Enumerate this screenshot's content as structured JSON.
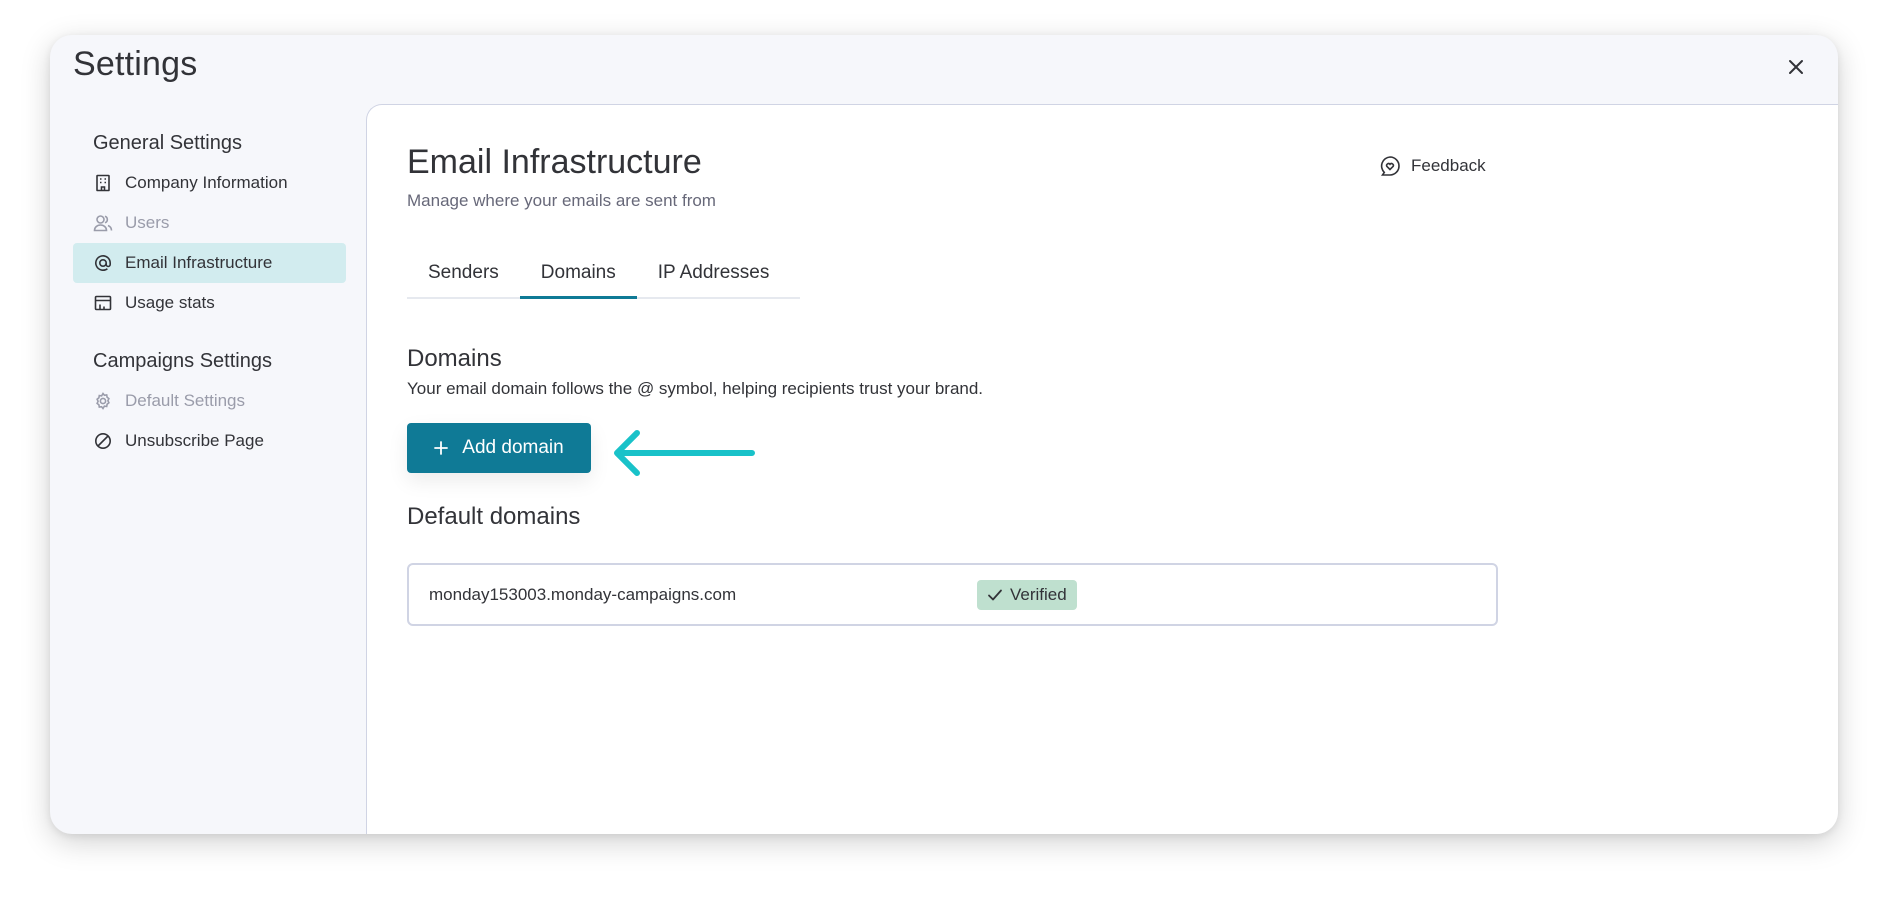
{
  "modal": {
    "title": "Settings"
  },
  "sidebar": {
    "general_title": "General Settings",
    "general_items": [
      {
        "label": "Company Information",
        "icon": "building-icon"
      },
      {
        "label": "Users",
        "icon": "users-icon",
        "disabled": true
      },
      {
        "label": "Email Infrastructure",
        "icon": "at-sign-icon",
        "active": true
      },
      {
        "label": "Usage stats",
        "icon": "usage-stats-icon"
      }
    ],
    "campaigns_title": "Campaigns Settings",
    "campaigns_items": [
      {
        "label": "Default Settings",
        "icon": "gear-icon",
        "disabled": true
      },
      {
        "label": "Unsubscribe Page",
        "icon": "prohibited-icon"
      }
    ]
  },
  "main": {
    "title": "Email Infrastructure",
    "subtitle": "Manage where your emails are sent from",
    "feedback_label": "Feedback",
    "tabs": [
      {
        "label": "Senders"
      },
      {
        "label": "Domains",
        "active": true
      },
      {
        "label": "IP Addresses"
      }
    ],
    "domains_heading": "Domains",
    "domains_description": "Your email domain follows the @ symbol, helping recipients trust your brand.",
    "add_domain_label": "Add domain",
    "default_domains_heading": "Default domains",
    "default_domains": [
      {
        "domain": "monday153003.monday-campaigns.com",
        "status": "Verified"
      }
    ]
  },
  "colors": {
    "accent": "#0f7a96",
    "active_nav_bg": "#d2ecef",
    "verified_badge_bg": "#bfe0cf",
    "annotation_arrow": "#19c2c9"
  }
}
